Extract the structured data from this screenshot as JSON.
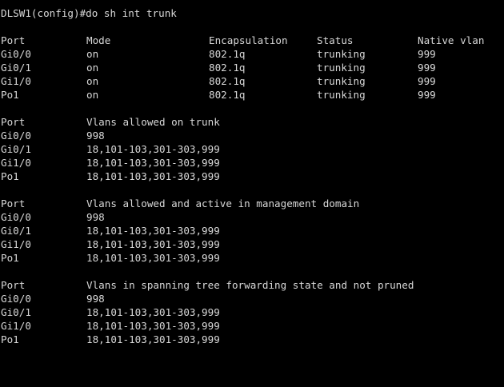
{
  "prompt": "DLSW1(config)#do sh int trunk",
  "mode_table": {
    "headers": [
      "Port",
      "Mode",
      "Encapsulation",
      "Status",
      "Native vlan"
    ],
    "rows": [
      [
        "Gi0/0",
        "on",
        "802.1q",
        "trunking",
        "999"
      ],
      [
        "Gi0/1",
        "on",
        "802.1q",
        "trunking",
        "999"
      ],
      [
        "Gi1/0",
        "on",
        "802.1q",
        "trunking",
        "999"
      ],
      [
        "Po1",
        "on",
        "802.1q",
        "trunking",
        "999"
      ]
    ]
  },
  "allowed": {
    "headers": [
      "Port",
      "Vlans allowed on trunk"
    ],
    "rows": [
      [
        "Gi0/0",
        "998"
      ],
      [
        "Gi0/1",
        "18,101-103,301-303,999"
      ],
      [
        "Gi1/0",
        "18,101-103,301-303,999"
      ],
      [
        "Po1",
        "18,101-103,301-303,999"
      ]
    ]
  },
  "active": {
    "headers": [
      "Port",
      "Vlans allowed and active in management domain"
    ],
    "rows": [
      [
        "Gi0/0",
        "998"
      ],
      [
        "Gi0/1",
        "18,101-103,301-303,999"
      ],
      [
        "Gi1/0",
        "18,101-103,301-303,999"
      ],
      [
        "Po1",
        "18,101-103,301-303,999"
      ]
    ]
  },
  "forwarding": {
    "headers": [
      "Port",
      "Vlans in spanning tree forwarding state and not pruned"
    ],
    "rows": [
      [
        "Gi0/0",
        "998"
      ],
      [
        "Gi0/1",
        "18,101-103,301-303,999"
      ],
      [
        "Gi1/0",
        "18,101-103,301-303,999"
      ],
      [
        "Po1",
        "18,101-103,301-303,999"
      ]
    ]
  }
}
